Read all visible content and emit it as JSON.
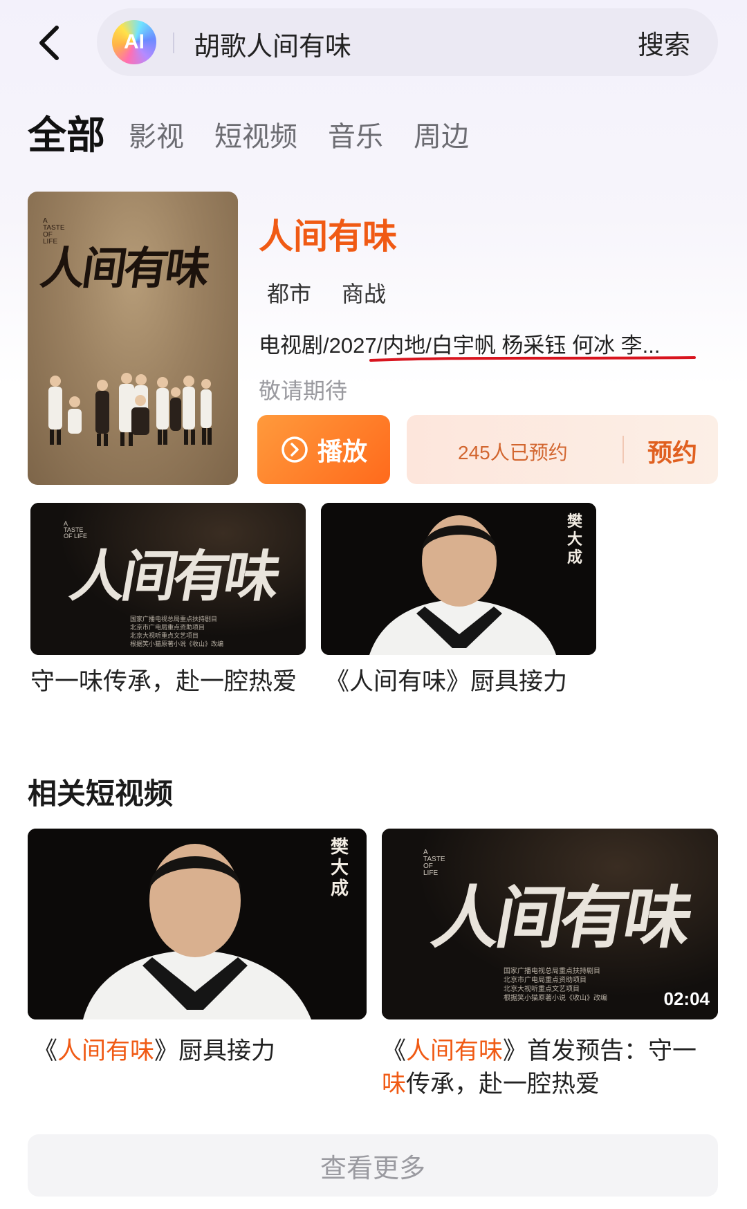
{
  "search": {
    "ai_label": "AI",
    "query": "胡歌人间有味",
    "button_label": "搜索"
  },
  "tabs": [
    {
      "label": "全部",
      "active": true
    },
    {
      "label": "影视",
      "active": false
    },
    {
      "label": "短视频",
      "active": false
    },
    {
      "label": "音乐",
      "active": false
    },
    {
      "label": "周边",
      "active": false
    }
  ],
  "show": {
    "title": "人间有味",
    "poster_title": "人间有味",
    "poster_subtitle": "A TASTE OF LIFE",
    "genres": [
      "都市",
      "商战"
    ],
    "meta": "电视剧/2027/内地/白宇帆 杨采钰 何冰 李...",
    "status": "敬请期待",
    "play_label": "播放",
    "reserve_count": "245人已预约",
    "reserve_label": "预约"
  },
  "clips": [
    {
      "caption": "守一味传承，赴一腔热爱",
      "thumb_title": "人间有味",
      "thumb_eng": "A TASTE OF LIFE",
      "thumb_credits": [
        "国家广播电视总局重点扶持剧目",
        "北京市广电局重点资助项目",
        "北京大视听重点文艺项目",
        "根据笑小猫原著小说《收山》改编"
      ]
    },
    {
      "caption": "《人间有味》厨具接力",
      "thumb_role": "樊大成"
    }
  ],
  "related": {
    "section_title": "相关短视频",
    "videos": [
      {
        "caption_pre": "《",
        "caption_hl": "人间有味",
        "caption_post": "》厨具接力",
        "thumb_role": "樊大成"
      },
      {
        "caption_pre": "《",
        "caption_hl": "人间有味",
        "caption_mid": "》首发预告：守一",
        "caption_hl2": "味",
        "caption_post": "传承，赴一腔热爱",
        "thumb_title": "人间有味",
        "thumb_eng": "A TASTE OF LIFE",
        "thumb_credits": [
          "国家广播电视总局重点扶持剧目",
          "北京市广电局重点资助项目",
          "北京大视听重点文艺项目",
          "根据笑小猫原著小说《收山》改编"
        ],
        "duration": "02:04"
      }
    ]
  },
  "more_label": "查看更多",
  "colors": {
    "accent": "#f05a14",
    "play_gradient_start": "#ff9a3c",
    "play_gradient_end": "#ff6a1c",
    "reserve_bg": "#fde6dc",
    "underline": "#d8141e"
  },
  "icons": {
    "back": "chevron-left-icon",
    "play": "play-circle-icon"
  }
}
